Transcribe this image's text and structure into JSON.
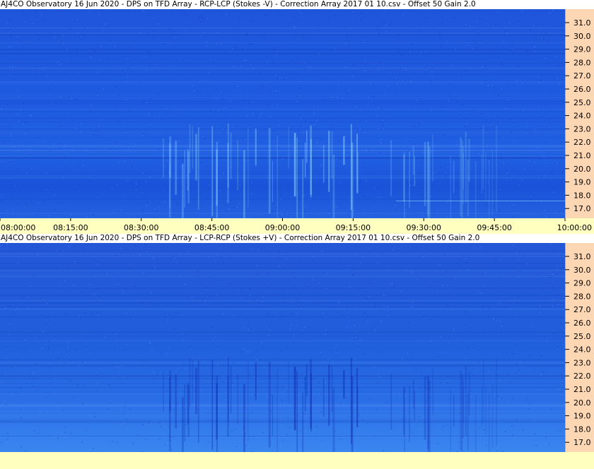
{
  "colors": {
    "background_top": "#1d5ee0",
    "background_bottom": "#2a6ce8",
    "ruler_bg": "#fdd7b4",
    "timebar_bg": "#ffffc0",
    "burst_top": "#9fe8ff",
    "burst_bottom": "#0a1ea8"
  },
  "chart_data": [
    {
      "type": "heatmap",
      "title": "AJ4CO Observatory 16 Jun 2020  -  DPS on TFD Array  -  RCP-LCP (Stokes -V)  -  Correction Array 2017 01 10.csv  -  Offset 50  Gain 2.0",
      "ylim": [
        16.3,
        32.0
      ],
      "y_ticks": [
        "17.0",
        "18.0",
        "19.0",
        "20.0",
        "21.0",
        "22.0",
        "23.0",
        "24.0",
        "25.0",
        "26.0",
        "27.0",
        "28.0",
        "29.0",
        "30.0",
        "31.0"
      ],
      "x_ticks": [
        "08:00:00",
        "08:15:00",
        "08:30:00",
        "08:45:00",
        "09:00:00",
        "09:15:00",
        "09:30:00",
        "09:45:00",
        "10:00:00"
      ],
      "bursts_color": "bright"
    },
    {
      "type": "heatmap",
      "title": "AJ4CO Observatory 16 Jun 2020  -  DPS on TFD Array  -  LCP-RCP (Stokes +V)  -  Correction Array 2017 01 10.csv  -  Offset 50  Gain 2.0",
      "ylim": [
        16.3,
        32.0
      ],
      "y_ticks": [
        "17.0",
        "18.0",
        "19.0",
        "20.0",
        "21.0",
        "22.0",
        "23.0",
        "24.0",
        "25.0",
        "26.0",
        "27.0",
        "28.0",
        "29.0",
        "30.0",
        "31.0"
      ],
      "bursts_color": "dark"
    }
  ]
}
